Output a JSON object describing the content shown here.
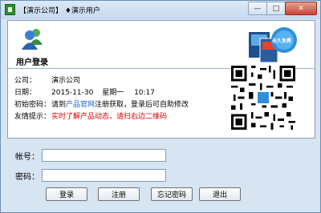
{
  "window": {
    "title": "【演示公司】 ♦演示用户",
    "minimize": "—",
    "maximize": "□",
    "close": "✕"
  },
  "header": {
    "user_login_label": "用户登录",
    "promo_badge": "永久免费"
  },
  "info": {
    "company": {
      "label": "公司：",
      "value": "演示公司"
    },
    "date": {
      "label": "日期：",
      "value": "2015-11-30",
      "weekday": "星期一",
      "time": "10:17"
    },
    "password": {
      "label": "初始密码：",
      "prefix": "请到",
      "link": "产品官网",
      "suffix": "注册获取，登录后可自助修改"
    },
    "tip": {
      "label": "友情提示：",
      "value": "实时了解产品动态，请扫右边二维码"
    }
  },
  "form": {
    "account_label": "帐号：",
    "account_value": "",
    "password_label": "密码：",
    "password_value": ""
  },
  "buttons": {
    "login": "登录",
    "register": "注册",
    "forgot": "忘记密码",
    "exit": "退出"
  },
  "colors": {
    "link": "#1a5fd0",
    "tip": "#e00000",
    "window_bg": "#d7e4f2"
  }
}
